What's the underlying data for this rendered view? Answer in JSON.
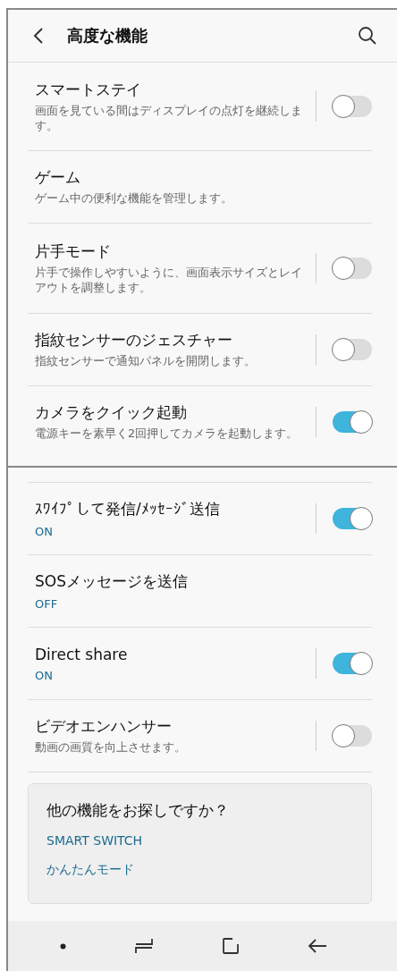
{
  "header": {
    "title": "高度な機能"
  },
  "sections": [
    {
      "items": [
        {
          "kind": "toggle",
          "title": "スマートステイ",
          "description": "画面を見ている間はディスプレイの点灯を継続します。",
          "on": false
        },
        {
          "kind": "link",
          "title": "ゲーム",
          "description": "ゲーム中の便利な機能を管理します。"
        },
        {
          "kind": "toggle",
          "title": "片手モード",
          "description": "片手で操作しやすいように、画面表示サイズとレイアウトを調整します。",
          "on": false
        },
        {
          "kind": "toggle",
          "title": "指紋センサーのジェスチャー",
          "description": "指紋センサーで通知パネルを開閉します。",
          "on": false
        },
        {
          "kind": "toggle",
          "title": "カメラをクイック起動",
          "description": "電源キーを素早く2回押してカメラを起動します。",
          "on": true
        }
      ]
    },
    {
      "items": [
        {
          "kind": "toggle",
          "title": "ｽﾜｲﾌﾟして発信/ﾒｯｾｰｼﾞ送信",
          "status": "ON",
          "on": true
        },
        {
          "kind": "link",
          "title": "SOSメッセージを送信",
          "status": "OFF"
        },
        {
          "kind": "toggle",
          "title": "Direct share",
          "status": "ON",
          "on": true
        },
        {
          "kind": "toggle",
          "title": "ビデオエンハンサー",
          "description": "動画の画質を向上させます。",
          "on": false
        }
      ]
    }
  ],
  "suggestions": {
    "title": "他の機能をお探しですか？",
    "links": [
      "SMART SWITCH",
      "かんたんモード"
    ]
  }
}
